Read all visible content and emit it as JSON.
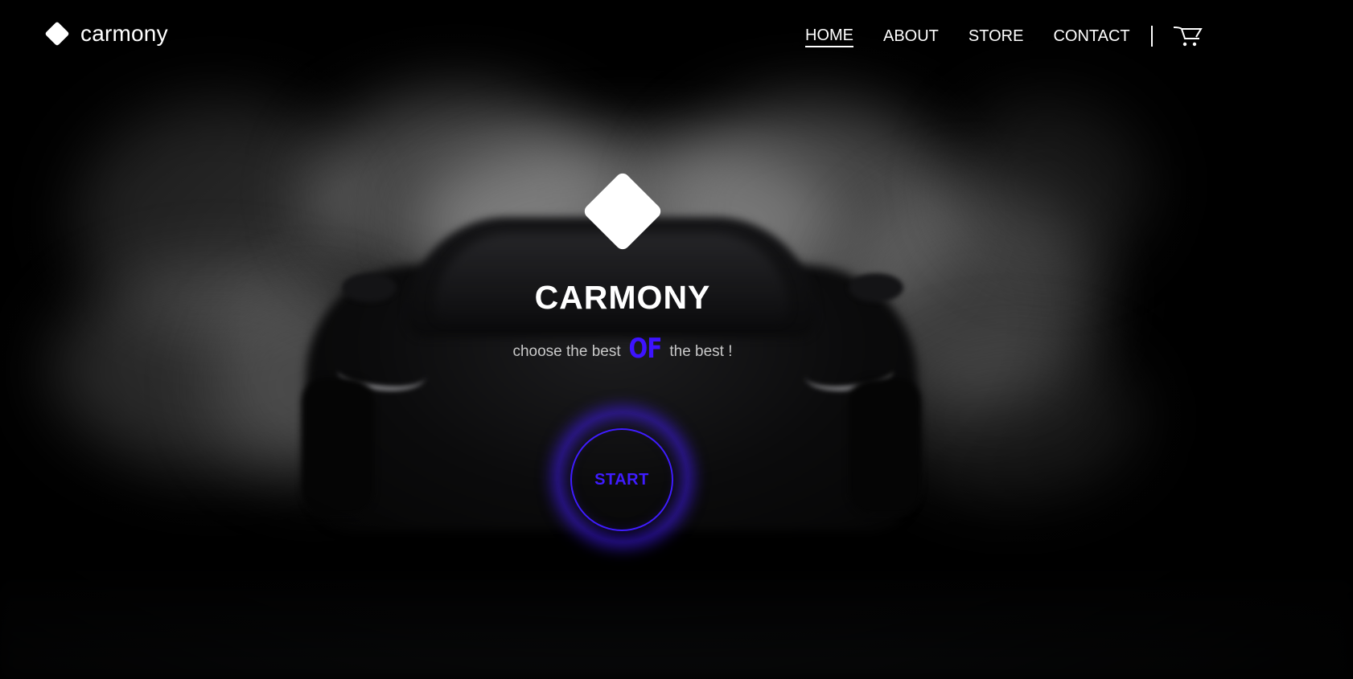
{
  "brand": {
    "icon": "diamond-logo-icon",
    "name": "carmony"
  },
  "nav": {
    "items": [
      {
        "label": "HOME",
        "active": true
      },
      {
        "label": "ABOUT",
        "active": false
      },
      {
        "label": "STORE",
        "active": false
      },
      {
        "label": "CONTACT",
        "active": false
      }
    ],
    "cart_icon": "shopping-cart-icon"
  },
  "hero": {
    "logo_icon": "diamond-logo-icon",
    "title": "CARMONY",
    "tagline_before": "choose the best",
    "tagline_accent": "OF",
    "tagline_after": "the best !",
    "start_label": "START"
  },
  "colors": {
    "accent": "#3d13ff",
    "background": "#000000",
    "text": "#ffffff"
  }
}
